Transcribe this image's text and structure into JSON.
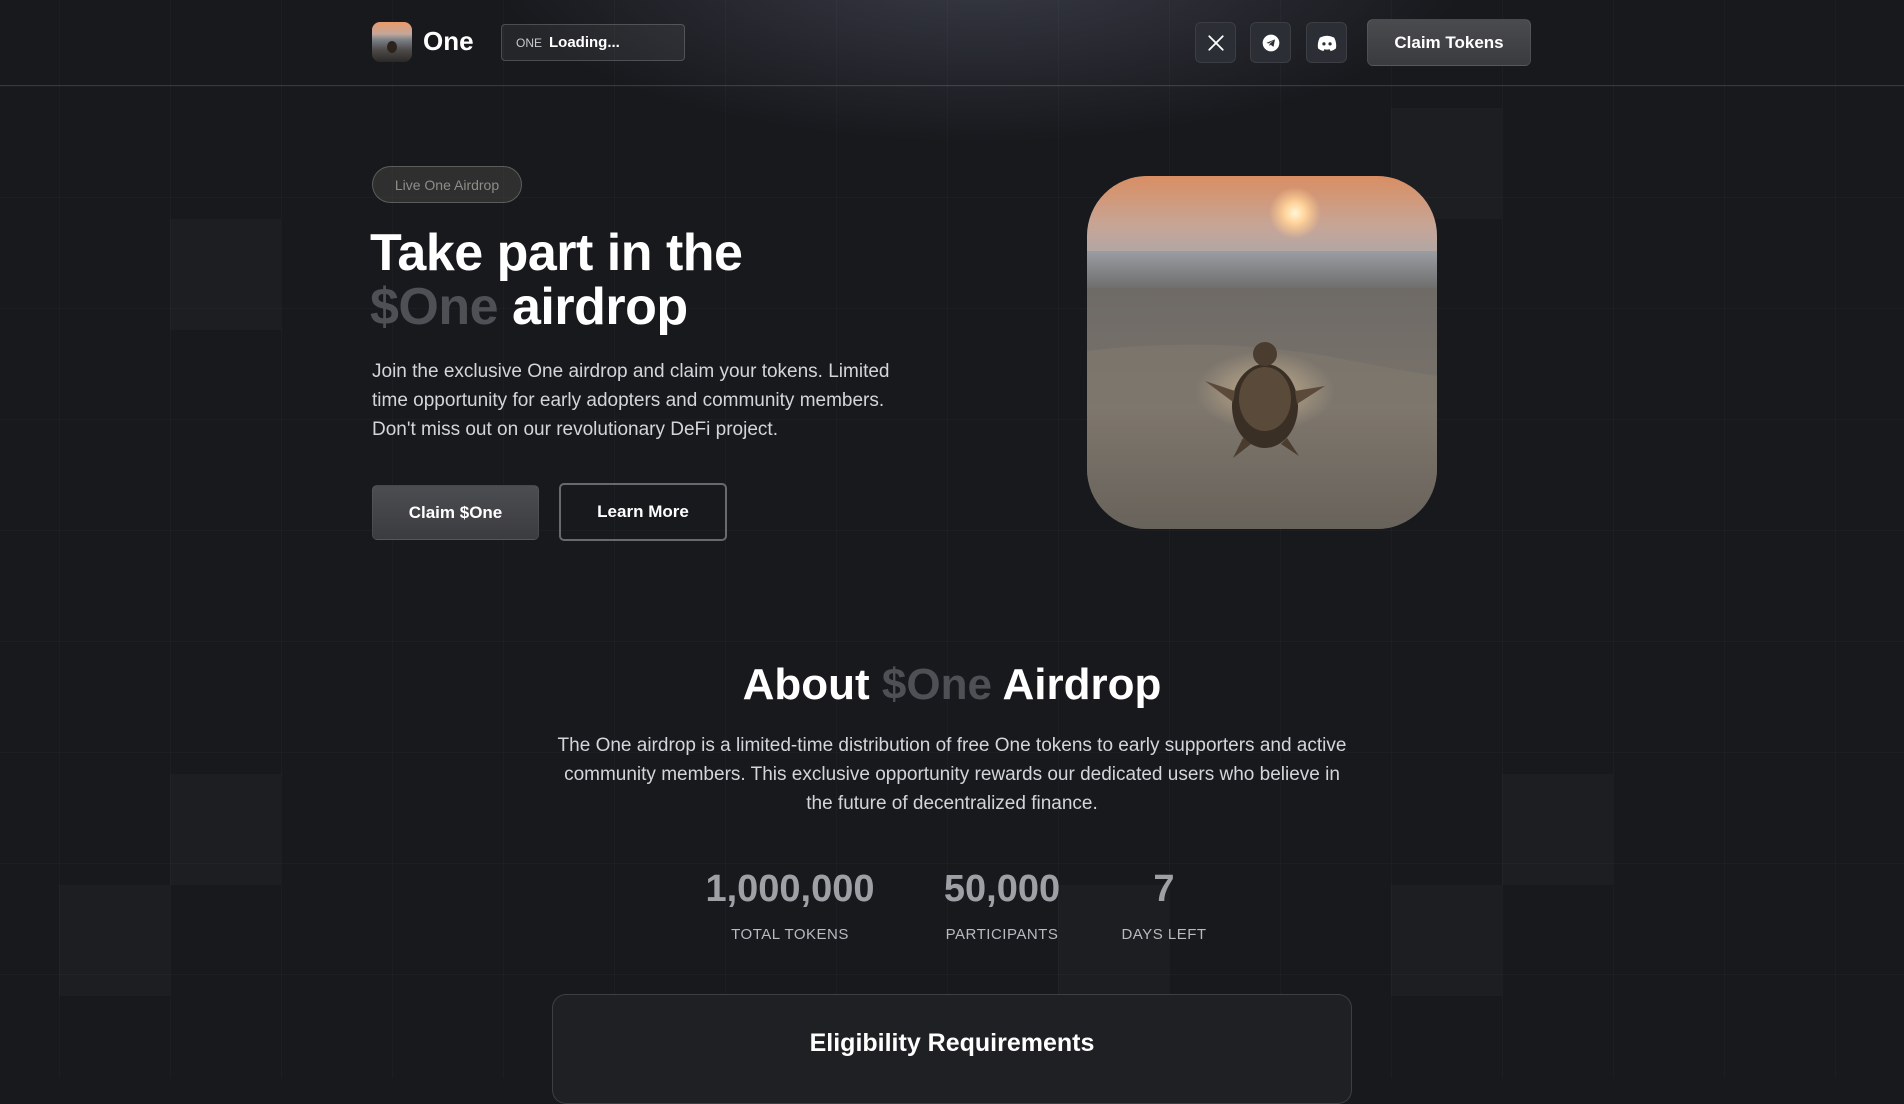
{
  "header": {
    "brand": "One",
    "price_symbol": "ONE",
    "price_value": "Loading...",
    "social": [
      "x-icon",
      "telegram-icon",
      "discord-icon"
    ],
    "claim_button": "Claim Tokens"
  },
  "hero": {
    "badge": "Live One Airdrop",
    "title_line1": "Take part in the",
    "title_highlight": "$One",
    "title_rest": "airdrop",
    "description": " Join the exclusive One airdrop and claim your tokens. Limited time opportunity for early adopters and community members. Don't miss out on our revolutionary DeFi project.",
    "claim_button": "Claim $One",
    "learn_button": "Learn More"
  },
  "about": {
    "title_pre": "About",
    "title_highlight": "$One",
    "title_post": "Airdrop",
    "description": "The One airdrop is a limited-time distribution of free One tokens to early supporters and active community members. This exclusive opportunity rewards our dedicated users who believe in the future of decentralized finance.",
    "stats": [
      {
        "value": "1,000,000",
        "label": "TOTAL TOKENS"
      },
      {
        "value": "50,000",
        "label": "PARTICIPANTS"
      },
      {
        "value": "7",
        "label": "DAYS LEFT"
      }
    ]
  },
  "eligibility": {
    "title": "Eligibility Requirements"
  },
  "colors": {
    "background": "#18191d",
    "muted_highlight": "#4f5055",
    "stat_value": "#9fa0a5"
  }
}
